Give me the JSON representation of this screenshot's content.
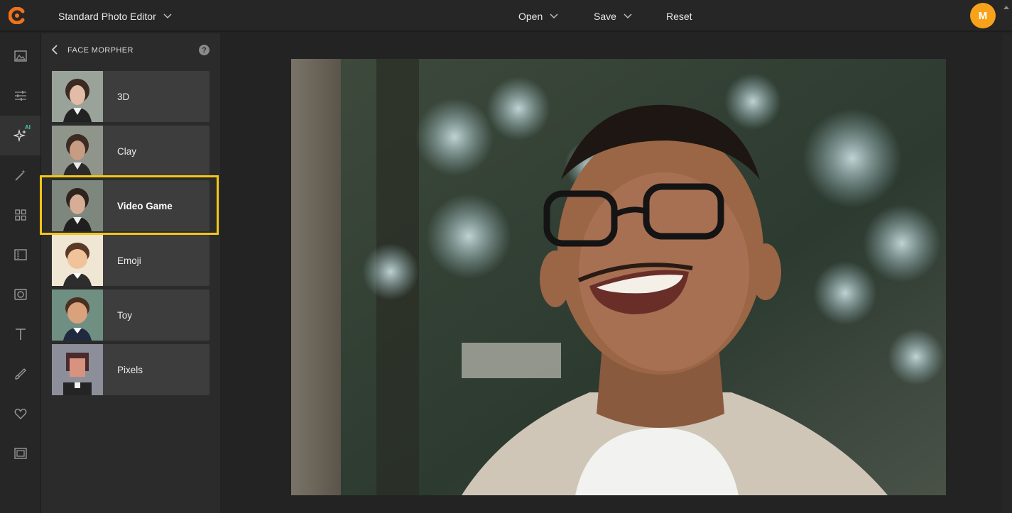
{
  "topbar": {
    "editor_select_label": "Standard Photo Editor",
    "menu": {
      "open_label": "Open",
      "save_label": "Save",
      "reset_label": "Reset"
    },
    "avatar_initial": "M"
  },
  "rail": {
    "ai_badge": "AI",
    "items": [
      {
        "icon": "image-icon"
      },
      {
        "icon": "adjust-sliders-icon"
      },
      {
        "icon": "ai-sparkle-icon",
        "active": true
      },
      {
        "icon": "magic-wand-icon"
      },
      {
        "icon": "grid-icon"
      },
      {
        "icon": "texture-icon"
      },
      {
        "icon": "frame-icon"
      },
      {
        "icon": "text-icon"
      },
      {
        "icon": "brush-icon"
      },
      {
        "icon": "heart-icon"
      },
      {
        "icon": "border-icon"
      }
    ]
  },
  "panel": {
    "title": "FACE MORPHER",
    "help_label": "?",
    "styles": [
      {
        "label": "3D"
      },
      {
        "label": "Clay"
      },
      {
        "label": "Video Game",
        "selected": true
      },
      {
        "label": "Emoji"
      },
      {
        "label": "Toy"
      },
      {
        "label": "Pixels"
      }
    ]
  },
  "colors": {
    "accent_selection": "#f5c518",
    "avatar_bg": "#f7a21a",
    "ai_badge": "#49c9b0"
  }
}
